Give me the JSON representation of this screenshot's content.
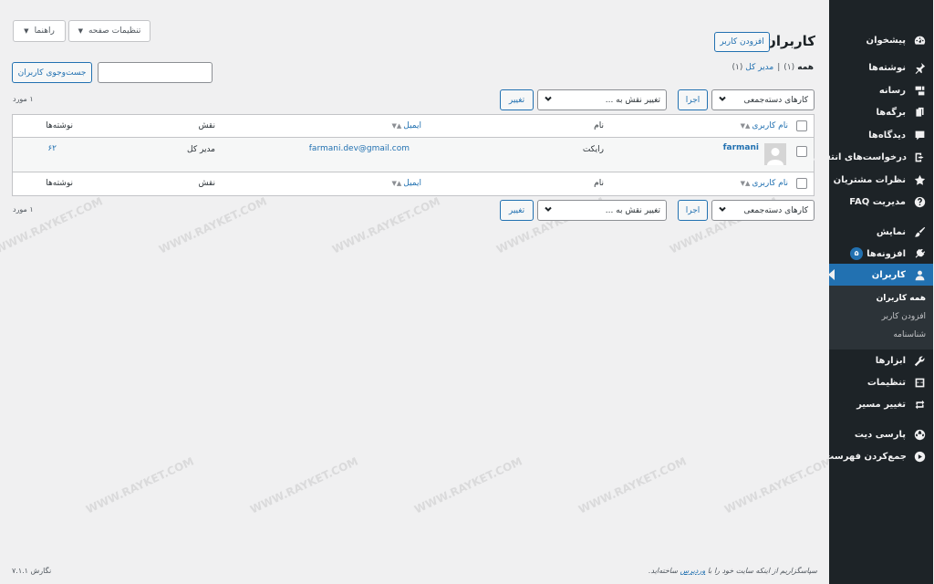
{
  "top_buttons": {
    "screen_options": "تنظیمات صفحه",
    "help": "راهنما"
  },
  "page": {
    "title": "کاربران",
    "add_new": "افزودن کاربر"
  },
  "filters": {
    "all_label": "همه",
    "all_count": "(۱)",
    "separator": "|",
    "admin_label": "مدیر کل",
    "admin_count": "(۱)"
  },
  "search": {
    "button": "جست‌وجوی کاربران",
    "value": ""
  },
  "tablenav_top": {
    "bulk": "کارهای دسته‌جمعی",
    "apply": "اجرا",
    "change_role": "تغییر نقش به ...",
    "change": "تغییر",
    "count": "۱ مورد"
  },
  "tablenav_bottom": {
    "bulk": "کارهای دسته‌جمعی",
    "apply": "اجرا",
    "change_role": "تغییر نقش به ...",
    "change": "تغییر",
    "count": "۱ مورد"
  },
  "columns": {
    "username": "نام کاربری",
    "name": "نام",
    "email": "ایمیل",
    "role": "نقش",
    "posts": "نوشته‌ها"
  },
  "rows": [
    {
      "username": "farmani",
      "name": "رایکت",
      "email": "farmani.dev@gmail.com",
      "role": "مدیر کل",
      "posts": "۶۲"
    }
  ],
  "sidebar": {
    "items": [
      {
        "label": "پیشخوان",
        "icon": "dashboard-icon"
      },
      {
        "label": "نوشته‌ها",
        "icon": "pin-icon"
      },
      {
        "label": "رسانه",
        "icon": "media-icon"
      },
      {
        "label": "برگه‌ها",
        "icon": "pages-icon"
      },
      {
        "label": "دیدگاه‌ها",
        "icon": "comment-icon"
      },
      {
        "label": "درخواست‌های انتقال",
        "icon": "exit-icon"
      },
      {
        "label": "نظرات مشتریان",
        "icon": "star-icon"
      },
      {
        "label": "مدیریت FAQ",
        "icon": "help-icon"
      },
      {
        "label": "نمایش",
        "icon": "brush-icon"
      },
      {
        "label": "افزونه‌ها",
        "icon": "plugin-icon",
        "badge": "۵"
      },
      {
        "label": "کاربران",
        "icon": "user-icon"
      },
      {
        "label": "ابزارها",
        "icon": "wrench-icon"
      },
      {
        "label": "تنظیمات",
        "icon": "settings-icon"
      },
      {
        "label": "تغییر مسیر",
        "icon": "redirect-icon"
      },
      {
        "label": "پارسی دیت",
        "icon": "globe-icon"
      },
      {
        "label": "جمع‌کردن فهرست",
        "icon": "collapse-icon"
      }
    ],
    "submenu": [
      "همه کاربران",
      "افزودن کاربر",
      "شناسنامه"
    ]
  },
  "footer": {
    "text_before": "سپاسگزاریم از اینکه سایت خود را با",
    "link": "وردپرس",
    "text_after": "ساخته‌اید.",
    "version": "نگارش ۷.۱.۱"
  },
  "watermark": "WWW.RAYKET.COM",
  "colors": {
    "accent": "#2271b1",
    "sidebar_bg": "#1d2327",
    "submenu_bg": "#2c3338",
    "page_bg": "#f0f0f1"
  }
}
